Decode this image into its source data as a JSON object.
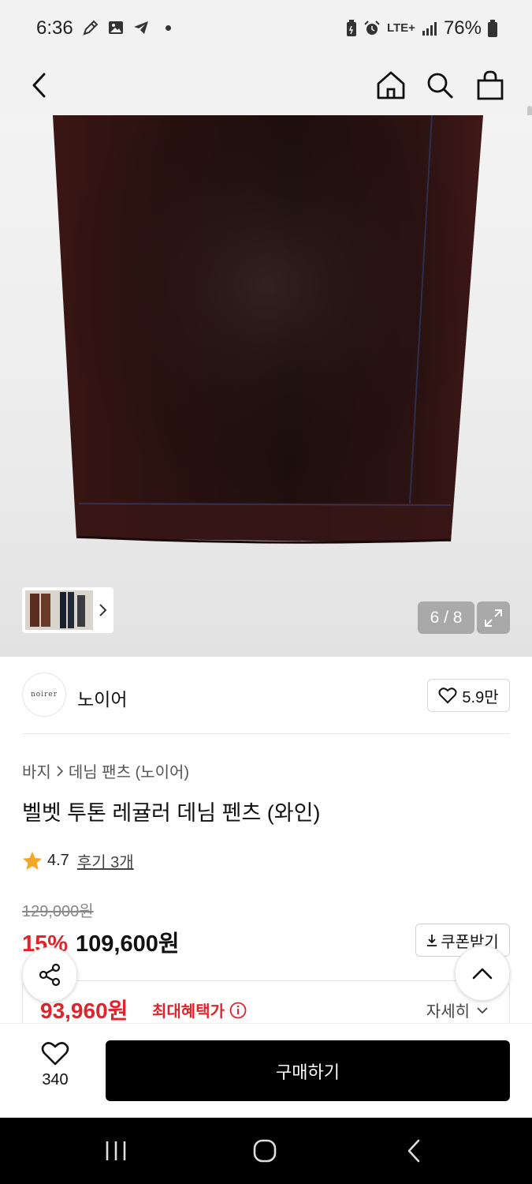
{
  "status_bar": {
    "time": "6:36",
    "network": "LTE+",
    "battery": "76%",
    "left_icons": [
      "pencil-icon",
      "gallery-icon",
      "telegram-icon",
      "dot"
    ],
    "right_icons": [
      "battery-saver-icon",
      "alarm-icon",
      "lte-icon",
      "signal-icon",
      "battery-icon"
    ]
  },
  "nav": {
    "icons": [
      "back-arrow-icon",
      "home-icon",
      "search-icon",
      "shopping-bag-icon"
    ]
  },
  "gallery": {
    "counter": "6 / 8",
    "thumbnail_icon": "chevron-right-icon",
    "expand_icon": "expand-icon"
  },
  "brand": {
    "logo_text": "noirer",
    "name": "노이어",
    "likes": "5.9만"
  },
  "breadcrumb": {
    "category": "바지",
    "subcategory": "데님 팬츠 (노이어)"
  },
  "product": {
    "title": "벨벳 투톤 레귤러 데님 펜츠 (와인)",
    "rating": "4.7",
    "review_link": "후기 3개",
    "original_price": "129,000원",
    "discount_rate": "15%",
    "sale_price": "109,600원",
    "coupon_label": "쿠폰받기",
    "benefit_price": "93,960원",
    "benefit_label": "최대혜택가",
    "detail_label": "자세히"
  },
  "bottom_bar": {
    "wish_count": "340",
    "buy_label": "구매하기"
  },
  "colors": {
    "accent_red": "#e0242a",
    "buy_button": "#000000",
    "star": "#f5a623"
  }
}
